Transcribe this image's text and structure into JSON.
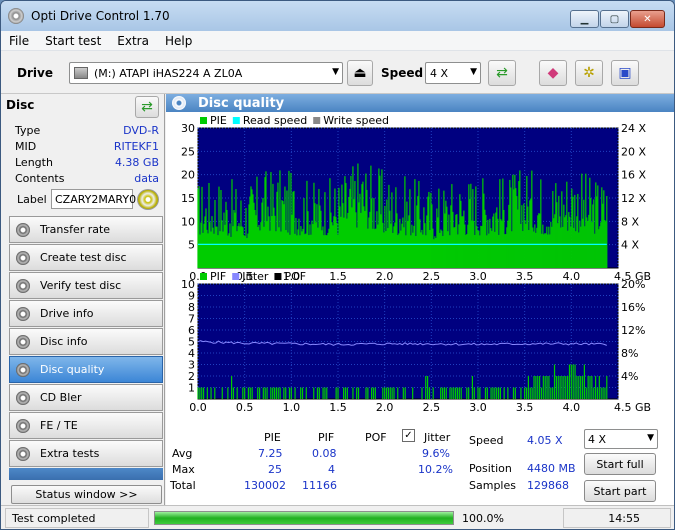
{
  "window": {
    "title": "Opti Drive Control 1.70",
    "min": "▁",
    "max": "▢",
    "close": "✕"
  },
  "menu": [
    "File",
    "Start test",
    "Extra",
    "Help"
  ],
  "drive": {
    "label": "Drive",
    "value": "(M:)   ATAPI iHAS224   A ZL0A",
    "speed_label": "Speed",
    "speed_value": "4 X"
  },
  "disc": {
    "header": "Disc",
    "rows": [
      {
        "k": "Type",
        "v": "DVD-R"
      },
      {
        "k": "MID",
        "v": "RITEKF1"
      },
      {
        "k": "Length",
        "v": "4.38 GB"
      },
      {
        "k": "Contents",
        "v": "data"
      }
    ],
    "label_key": "Label",
    "label_value": "CZARY2MARY0"
  },
  "nav": [
    {
      "label": "Transfer rate",
      "active": false
    },
    {
      "label": "Create test disc",
      "active": false
    },
    {
      "label": "Verify test disc",
      "active": false
    },
    {
      "label": "Drive info",
      "active": false
    },
    {
      "label": "Disc info",
      "active": false
    },
    {
      "label": "Disc quality",
      "active": true
    },
    {
      "label": "CD Bler",
      "active": false
    },
    {
      "label": "FE / TE",
      "active": false
    },
    {
      "label": "Extra tests",
      "active": false
    }
  ],
  "status_window": "Status window >>",
  "panel": {
    "title": "Disc quality"
  },
  "colors": {
    "pie": "#00cc00",
    "pif": "#00cc00",
    "jitter": "#8888ff",
    "read": "#00ffff",
    "write": "#888888",
    "plot_bg": "#000080",
    "pof_legend": "#000000"
  },
  "chart_data": [
    {
      "type": "area",
      "legend": [
        "PIE",
        "Read speed",
        "Write speed"
      ],
      "x_ticks": [
        "0.0",
        "0.5",
        "1.0",
        "1.5",
        "2.0",
        "2.5",
        "3.0",
        "3.5",
        "4.0",
        "4.5 GB"
      ],
      "y_ticks": [
        "30",
        "25",
        "20",
        "15",
        "10",
        "5"
      ],
      "y2_ticks": [
        "24 X",
        "20 X",
        "16 X",
        "12 X",
        "8 X",
        "4 X"
      ],
      "xlim": [
        0,
        4.5
      ],
      "ylim": [
        0,
        30
      ],
      "y2lim": [
        0,
        24
      ],
      "series": [
        {
          "name": "PIE",
          "x": [
            0.0,
            0.25,
            0.5,
            0.75,
            1.0,
            1.25,
            1.5,
            1.75,
            2.0,
            2.25,
            2.5,
            2.75,
            3.0,
            3.25,
            3.5,
            3.75,
            4.0,
            4.2,
            4.38
          ],
          "y": [
            7,
            7,
            6,
            8,
            7,
            7,
            7,
            9,
            7,
            7,
            6,
            7,
            7,
            7,
            8,
            7,
            8,
            7,
            8
          ]
        },
        {
          "name": "PIE peak",
          "x": [
            0.0,
            0.25,
            0.5,
            0.75,
            1.0,
            1.25,
            1.5,
            1.75,
            2.0,
            2.25,
            2.5,
            2.75,
            3.0,
            3.25,
            3.5,
            3.75,
            4.0,
            4.2,
            4.38
          ],
          "y": [
            19,
            20,
            18,
            22,
            21,
            19,
            20,
            25,
            21,
            20,
            18,
            20,
            21,
            20,
            22,
            21,
            23,
            20,
            20
          ]
        },
        {
          "name": "Read speed",
          "x": [
            0.0,
            4.38
          ],
          "y": [
            4.05,
            4.05
          ]
        }
      ]
    },
    {
      "type": "bar",
      "legend": [
        "PIF",
        "Jitter",
        "POF"
      ],
      "x_ticks": [
        "0.0",
        "0.5",
        "1.0",
        "1.5",
        "2.0",
        "2.5",
        "3.0",
        "3.5",
        "4.0",
        "4.5 GB"
      ],
      "y_ticks": [
        "10",
        "9",
        "8",
        "7",
        "6",
        "5",
        "4",
        "3",
        "2",
        "1"
      ],
      "y2_ticks": [
        "20%",
        "16%",
        "12%",
        "8%",
        "4%"
      ],
      "xlim": [
        0,
        4.5
      ],
      "ylim": [
        0,
        10
      ],
      "y2lim": [
        0,
        20
      ],
      "series": [
        {
          "name": "PIF",
          "x": [
            0.0,
            0.5,
            1.0,
            1.5,
            2.0,
            2.5,
            3.0,
            3.5,
            3.8,
            4.0,
            4.1,
            4.2,
            4.38
          ],
          "y": [
            1,
            1,
            1,
            1,
            1,
            1,
            1,
            2,
            3,
            4,
            3,
            2,
            2
          ]
        },
        {
          "name": "Jitter",
          "x": [
            0.0,
            0.5,
            1.0,
            1.5,
            2.0,
            2.5,
            3.0,
            3.5,
            4.0,
            4.38
          ],
          "y": [
            10.0,
            9.7,
            9.6,
            9.5,
            9.6,
            9.6,
            9.5,
            9.6,
            9.6,
            9.5
          ]
        }
      ]
    }
  ],
  "stats": {
    "headers": {
      "pie": "PIE",
      "pif": "PIF",
      "pof": "POF",
      "jitter": "Jitter"
    },
    "avg": {
      "label": "Avg",
      "pie": "7.25",
      "pif": "0.08",
      "jitter": "9.6%"
    },
    "max": {
      "label": "Max",
      "pie": "25",
      "pif": "4",
      "jitter": "10.2%"
    },
    "total": {
      "label": "Total",
      "pie": "130002",
      "pif": "11166"
    },
    "speed_label": "Speed",
    "speed_value": "4.05 X",
    "position_label": "Position",
    "position_value": "4480 MB",
    "samples_label": "Samples",
    "samples_value": "129868",
    "speed_select": "4 X",
    "start_full": "Start full",
    "start_part": "Start part"
  },
  "status": {
    "text": "Test completed",
    "progress": 100.0,
    "progress_label": "100.0%",
    "time": "14:55"
  }
}
